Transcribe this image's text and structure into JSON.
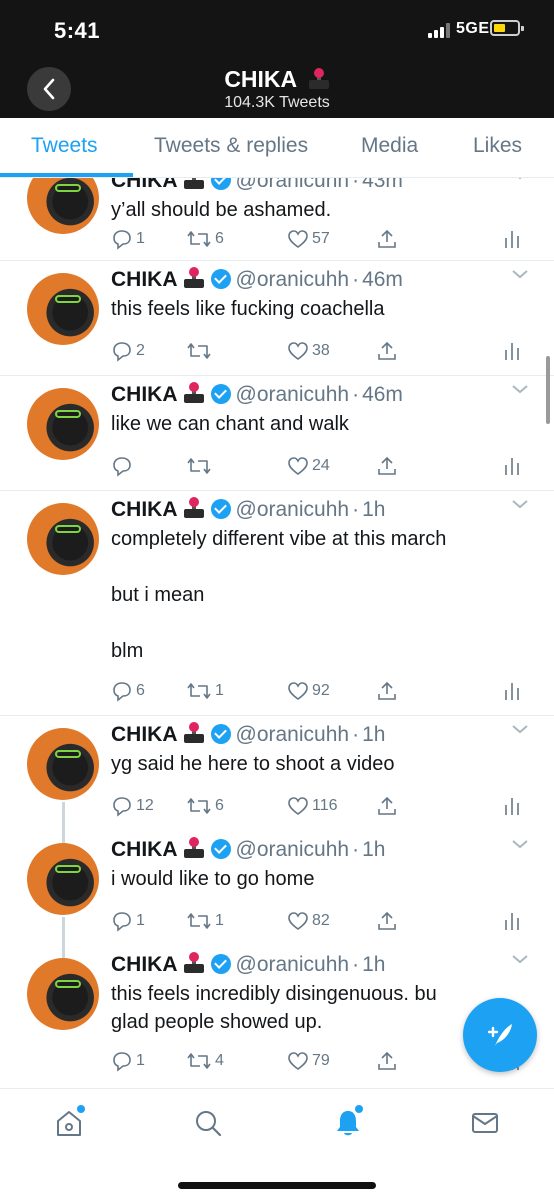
{
  "status_bar": {
    "time": "5:41",
    "network": "5GE"
  },
  "header": {
    "title": "CHIKA",
    "subtitle": "104.3K Tweets"
  },
  "tabs": [
    {
      "label": "Tweets",
      "active": true
    },
    {
      "label": "Tweets & replies",
      "active": false
    },
    {
      "label": "Media",
      "active": false
    },
    {
      "label": "Likes",
      "active": false
    }
  ],
  "tweets": [
    {
      "name": "CHIKA",
      "handle": "@oranicuhh",
      "time": "43m",
      "text": "y’all should be ashamed.",
      "replies": "1",
      "retweets": "6",
      "likes": "57"
    },
    {
      "name": "CHIKA",
      "handle": "@oranicuhh",
      "time": "46m",
      "text": "this feels like fucking coachella",
      "replies": "2",
      "retweets": "",
      "likes": "38"
    },
    {
      "name": "CHIKA",
      "handle": "@oranicuhh",
      "time": "46m",
      "text": "like we can chant and walk",
      "replies": "",
      "retweets": "",
      "likes": "24"
    },
    {
      "name": "CHIKA",
      "handle": "@oranicuhh",
      "time": "1h",
      "text": "completely different vibe at this march\n\nbut i mean\n\nblm",
      "replies": "6",
      "retweets": "1",
      "likes": "92"
    },
    {
      "name": "CHIKA",
      "handle": "@oranicuhh",
      "time": "1h",
      "text": "yg said he here to shoot a video",
      "replies": "12",
      "retweets": "6",
      "likes": "116"
    },
    {
      "name": "CHIKA",
      "handle": "@oranicuhh",
      "time": "1h",
      "text": "i would like to go home",
      "replies": "1",
      "retweets": "1",
      "likes": "82"
    },
    {
      "name": "CHIKA",
      "handle": "@oranicuhh",
      "time": "1h",
      "text": "this feels incredibly disingenuous. bu\nglad people showed up.",
      "replies": "1",
      "retweets": "4",
      "likes": "79"
    }
  ],
  "colors": {
    "accent": "#1da1f2",
    "header_bg": "#141414",
    "muted": "#657786"
  },
  "icons": {
    "back": "chevron-left-icon",
    "compose": "compose-tweet-icon",
    "home": "home-icon",
    "search": "search-icon",
    "notifications": "bell-icon",
    "messages": "mail-icon"
  }
}
